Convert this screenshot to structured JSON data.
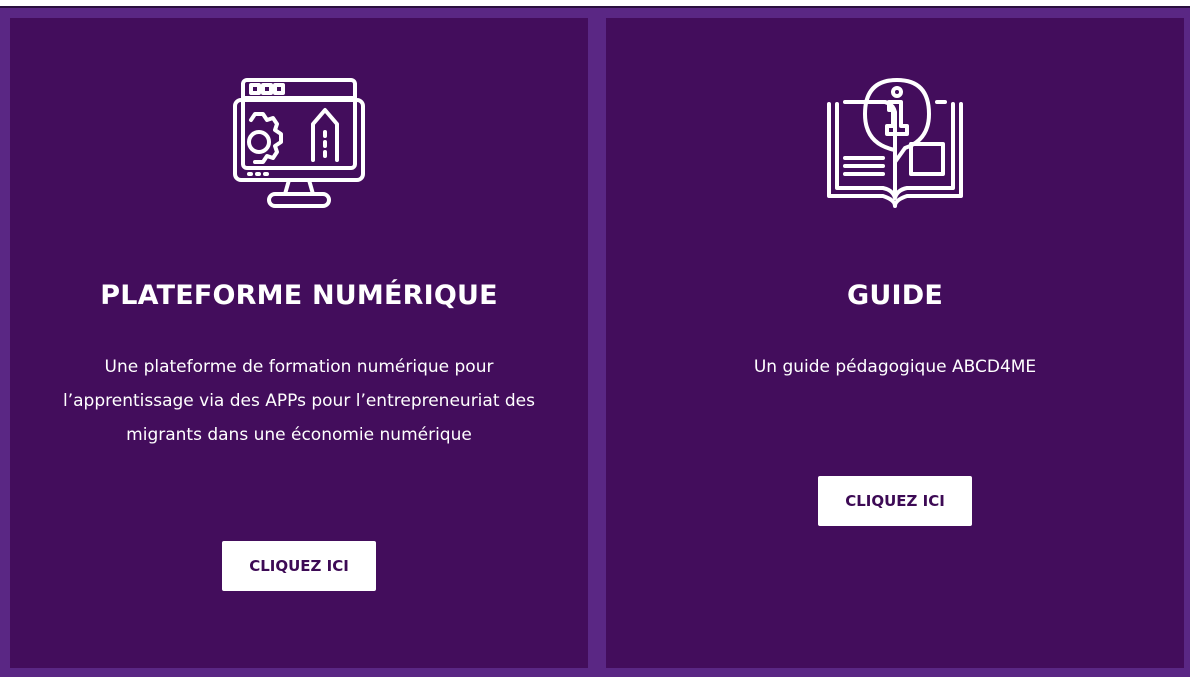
{
  "cards": [
    {
      "icon": "computer-design-icon",
      "title": "PLATEFORME NUMÉRIQUE",
      "description": "Une plateforme de formation numérique pour l’apprentissage via des APPs pour l’entrepreneuriat des migrants dans une économie numérique",
      "button_label": "CLIQUEZ ICI"
    },
    {
      "icon": "info-book-icon",
      "title": "GUIDE",
      "description": "Un guide pédagogique ABCD4ME",
      "button_label": "CLIQUEZ ICI"
    }
  ],
  "colors": {
    "frame": "#5a2784",
    "card": "#430d5c",
    "button_bg": "#ffffff",
    "button_text": "#3d0a55"
  }
}
